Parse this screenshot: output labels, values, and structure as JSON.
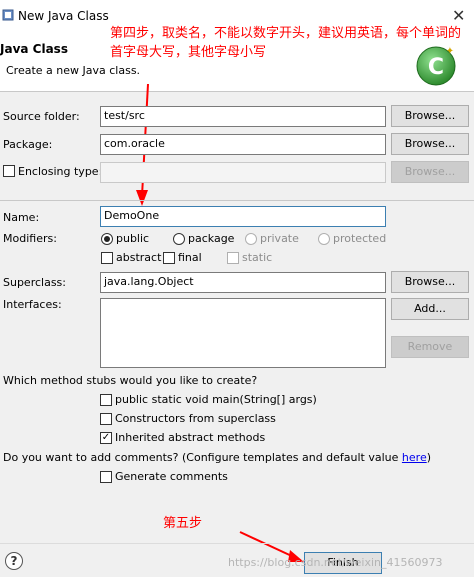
{
  "window": {
    "title": "New Java Class",
    "close_glyph": "✕"
  },
  "header": {
    "title": "Java Class",
    "description": "Create a new Java class."
  },
  "annotations": {
    "step4": "第四步，取类名，不能以数字开头，建议用英语，每个单词的首字母大写，其他字母小写",
    "step5": "第五步"
  },
  "form": {
    "source_folder": {
      "label": "Source folder:",
      "value": "test/src",
      "button": "Browse..."
    },
    "package": {
      "label": "Package:",
      "value": "com.oracle",
      "button": "Browse..."
    },
    "enclosing_type": {
      "label": "Enclosing type:",
      "value": "",
      "button": "Browse...",
      "checked": false
    },
    "name": {
      "label": "Name:",
      "value": "DemoOne"
    },
    "modifiers": {
      "label": "Modifiers:",
      "public": "public",
      "package": "package",
      "private": "private",
      "protected": "protected",
      "abstract": "abstract",
      "final": "final",
      "static": "static",
      "selected": "public"
    },
    "superclass": {
      "label": "Superclass:",
      "value": "java.lang.Object",
      "button": "Browse..."
    },
    "interfaces": {
      "label": "Interfaces:",
      "add_button": "Add...",
      "remove_button": "Remove"
    }
  },
  "stubs": {
    "question": "Which method stubs would you like to create?",
    "main": {
      "label": "public static void main(String[] args)",
      "checked": false
    },
    "constructors": {
      "label": "Constructors from superclass",
      "checked": false
    },
    "inherited": {
      "label": "Inherited abstract methods",
      "checked": true
    }
  },
  "comments": {
    "question": "Do you want to add comments? (Configure templates and default value ",
    "link": "here",
    "close_paren": ")",
    "generate": {
      "label": "Generate comments",
      "checked": false
    }
  },
  "footer": {
    "help_glyph": "?",
    "finish_button": "Finish",
    "watermark": "https://blog.csdn.net/weixin_41560973"
  },
  "icons": {
    "app": "java-class-icon",
    "logo": "new-class-wizard-icon",
    "help": "help-icon"
  },
  "colors": {
    "annotation": "#ff0000",
    "logo_green": "#3aa63a",
    "link": "#0000ee"
  }
}
